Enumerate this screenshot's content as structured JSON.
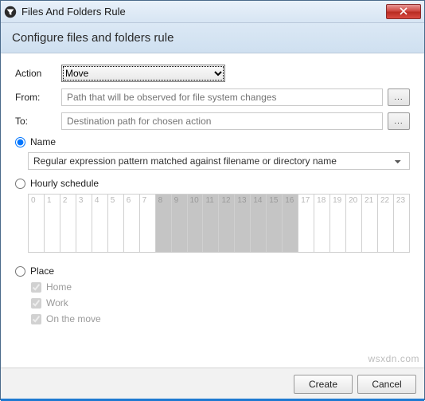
{
  "window": {
    "title": "Files And Folders Rule"
  },
  "header": {
    "subtitle": "Configure files and folders rule"
  },
  "form": {
    "action_label": "Action",
    "action_value": "Move",
    "from_label": "From:",
    "from_placeholder": "Path that will be observed for file system changes",
    "to_label": "To:",
    "to_placeholder": "Destination path for chosen action",
    "browse_label": "..."
  },
  "criteria": {
    "name_label": "Name",
    "name_selected": true,
    "pattern_value": "Regular expression pattern matched against filename or directory name",
    "hourly_label": "Hourly schedule",
    "hourly_selected": false,
    "hours": [
      {
        "h": "0",
        "sel": false
      },
      {
        "h": "1",
        "sel": false
      },
      {
        "h": "2",
        "sel": false
      },
      {
        "h": "3",
        "sel": false
      },
      {
        "h": "4",
        "sel": false
      },
      {
        "h": "5",
        "sel": false
      },
      {
        "h": "6",
        "sel": false
      },
      {
        "h": "7",
        "sel": false
      },
      {
        "h": "8",
        "sel": true
      },
      {
        "h": "9",
        "sel": true
      },
      {
        "h": "10",
        "sel": true
      },
      {
        "h": "11",
        "sel": true
      },
      {
        "h": "12",
        "sel": true
      },
      {
        "h": "13",
        "sel": true
      },
      {
        "h": "14",
        "sel": true
      },
      {
        "h": "15",
        "sel": true
      },
      {
        "h": "16",
        "sel": true
      },
      {
        "h": "17",
        "sel": false
      },
      {
        "h": "18",
        "sel": false
      },
      {
        "h": "19",
        "sel": false
      },
      {
        "h": "20",
        "sel": false
      },
      {
        "h": "21",
        "sel": false
      },
      {
        "h": "22",
        "sel": false
      },
      {
        "h": "23",
        "sel": false
      }
    ],
    "place_label": "Place",
    "place_selected": false,
    "places": [
      {
        "label": "Home",
        "checked": true
      },
      {
        "label": "Work",
        "checked": true
      },
      {
        "label": "On the move",
        "checked": true
      }
    ]
  },
  "footer": {
    "create_label": "Create",
    "cancel_label": "Cancel"
  },
  "watermark": "wsxdn.com"
}
